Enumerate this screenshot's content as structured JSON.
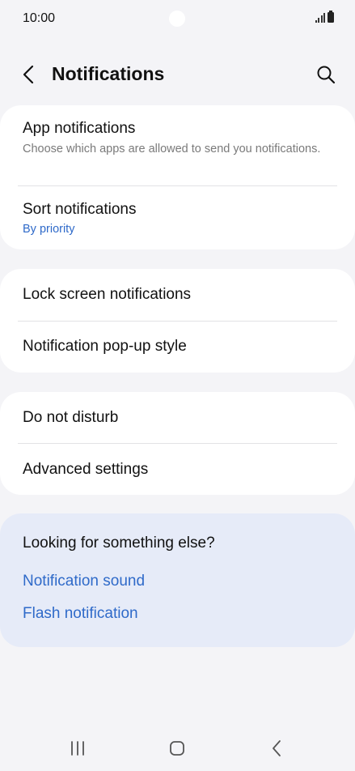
{
  "status_bar": {
    "time": "10:00",
    "icons": [
      "signal-icon",
      "battery-icon"
    ]
  },
  "header": {
    "title": "Notifications",
    "back_icon": "chevron-left-icon",
    "search_icon": "search-icon"
  },
  "sections": [
    {
      "items": [
        {
          "title": "App notifications",
          "subtitle": "Choose which apps are allowed to send you notifications."
        },
        {
          "title": "Sort notifications",
          "value": "By priority"
        }
      ]
    },
    {
      "items": [
        {
          "title": "Lock screen notifications"
        },
        {
          "title": "Notification pop-up style"
        }
      ]
    },
    {
      "items": [
        {
          "title": "Do not disturb"
        },
        {
          "title": "Advanced settings"
        }
      ]
    }
  ],
  "suggestions": {
    "title": "Looking for something else?",
    "links": [
      "Notification sound",
      "Flash notification"
    ]
  },
  "nav_bar": {
    "buttons": [
      "recent-apps-icon",
      "home-icon",
      "back-icon"
    ]
  },
  "colors": {
    "background": "#f4f4f7",
    "card": "#ffffff",
    "accent": "#2f6ac9",
    "suggestion_card": "#e6ebf8"
  }
}
